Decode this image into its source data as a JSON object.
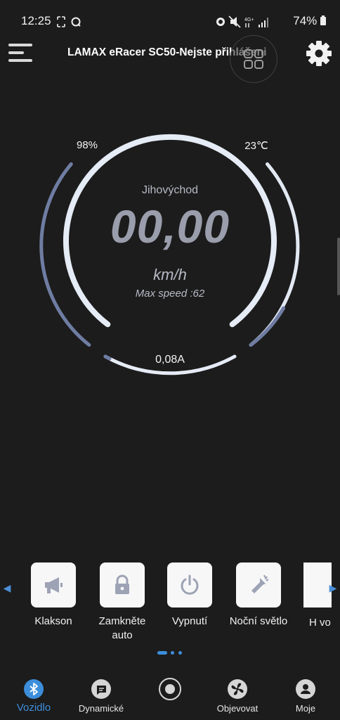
{
  "status_bar": {
    "time": "12:25",
    "battery": "74%"
  },
  "header": {
    "title": "LAMAX eRacer SC50-Nejste přihlášeni"
  },
  "gauge": {
    "battery_percent": "98%",
    "temperature": "23℃",
    "direction": "Jihovýchod",
    "speed": "00,00",
    "unit": "km/h",
    "max_speed": "Max speed :62",
    "current": "0,08A",
    "battery_level": 0.98,
    "temperature_level": 0.45,
    "current_level": 0.02
  },
  "controls": [
    {
      "label": "Klakson",
      "icon": "megaphone-icon"
    },
    {
      "label": "Zamkněte auto",
      "icon": "lock-icon"
    },
    {
      "label": "Vypnutí",
      "icon": "power-icon"
    },
    {
      "label": "Noční světlo",
      "icon": "flashlight-icon"
    },
    {
      "label": "H vo",
      "icon": "unknown-icon"
    }
  ],
  "bottom_nav": [
    {
      "label": "Vozidlo",
      "icon": "bluetooth-icon",
      "active": true
    },
    {
      "label": "Dynamické",
      "icon": "chat-icon",
      "active": false
    },
    {
      "label": "",
      "icon": "record-icon",
      "active": false
    },
    {
      "label": "Objevovat",
      "icon": "fan-icon",
      "active": false
    },
    {
      "label": "Moje",
      "icon": "person-icon",
      "active": false
    }
  ],
  "colors": {
    "background": "#1c1c1c",
    "accent": "#3c8edb",
    "gauge_ring": "#e6ecf6",
    "gauge_fill": "#7b8ab0",
    "speed_text": "#9a9dab"
  }
}
